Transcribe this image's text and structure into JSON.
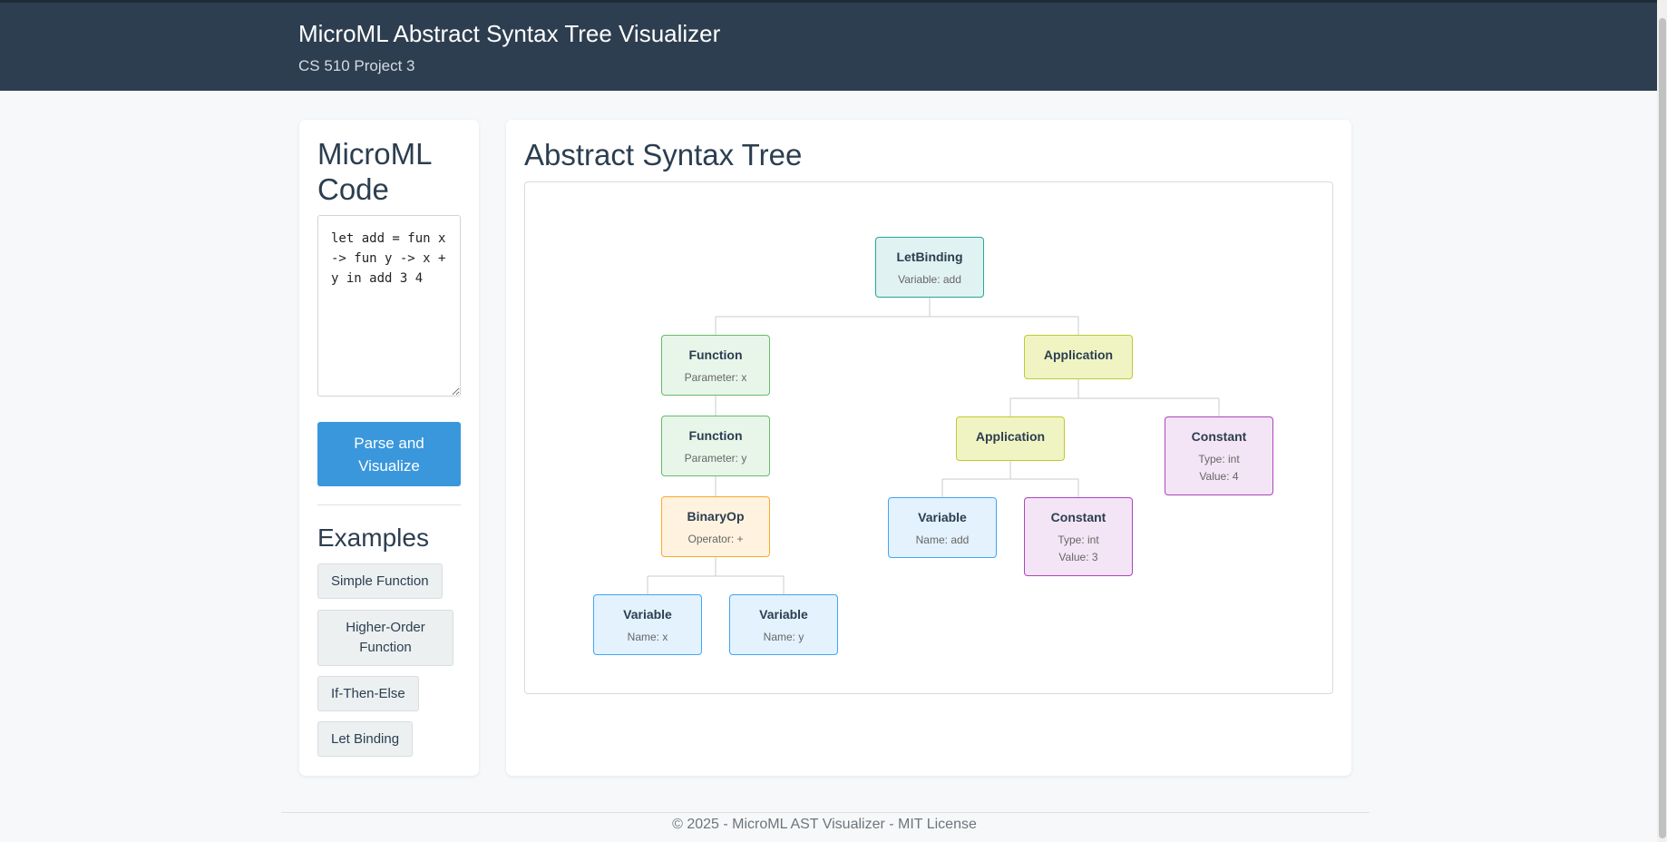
{
  "header": {
    "title": "MicroML Abstract Syntax Tree Visualizer",
    "subtitle": "CS 510 Project 3"
  },
  "editor": {
    "heading": "MicroML Code",
    "code": "let add = fun x -> fun y -> x + y in add 3 4",
    "parse_label": "Parse and Visualize"
  },
  "examples": {
    "heading": "Examples",
    "items": [
      {
        "label": "Simple Function"
      },
      {
        "label": "Higher-Order Function"
      },
      {
        "label": "If-Then-Else"
      },
      {
        "label": "Let Binding"
      }
    ]
  },
  "ast": {
    "heading": "Abstract Syntax Tree",
    "nodes": [
      {
        "type": "LetBinding",
        "details": [
          "Variable: add"
        ],
        "color": "letbinding"
      },
      {
        "type": "Function",
        "details": [
          "Parameter: x"
        ],
        "color": "function"
      },
      {
        "type": "Application",
        "details": [],
        "color": "application"
      },
      {
        "type": "Function",
        "details": [
          "Parameter: y"
        ],
        "color": "function"
      },
      {
        "type": "Application",
        "details": [],
        "color": "application"
      },
      {
        "type": "Constant",
        "details": [
          "Type: int",
          "Value: 4"
        ],
        "color": "constant"
      },
      {
        "type": "BinaryOp",
        "details": [
          "Operator: +"
        ],
        "color": "binaryop"
      },
      {
        "type": "Variable",
        "details": [
          "Name: add"
        ],
        "color": "variable"
      },
      {
        "type": "Constant",
        "details": [
          "Type: int",
          "Value: 3"
        ],
        "color": "constant"
      },
      {
        "type": "Variable",
        "details": [
          "Name: x"
        ],
        "color": "variable"
      },
      {
        "type": "Variable",
        "details": [
          "Name: y"
        ],
        "color": "variable"
      }
    ],
    "edges": [
      [
        0,
        1
      ],
      [
        0,
        2
      ],
      [
        1,
        3
      ],
      [
        2,
        4
      ],
      [
        2,
        5
      ],
      [
        3,
        6
      ],
      [
        4,
        7
      ],
      [
        4,
        8
      ],
      [
        6,
        9
      ],
      [
        6,
        10
      ]
    ]
  },
  "colors": {
    "letbinding": {
      "bg": "#e0f2f1",
      "border": "#26a69a"
    },
    "function": {
      "bg": "#e8f5e9",
      "border": "#66bb6a"
    },
    "application": {
      "bg": "#f0f4c3",
      "border": "#c0ca33"
    },
    "binaryop": {
      "bg": "#fff3e0",
      "border": "#ffa726"
    },
    "variable": {
      "bg": "#e3f2fd",
      "border": "#42a5f5"
    },
    "constant": {
      "bg": "#f3e5f5",
      "border": "#ab47bc"
    }
  },
  "footer": "© 2025 - MicroML AST Visualizer - MIT License"
}
